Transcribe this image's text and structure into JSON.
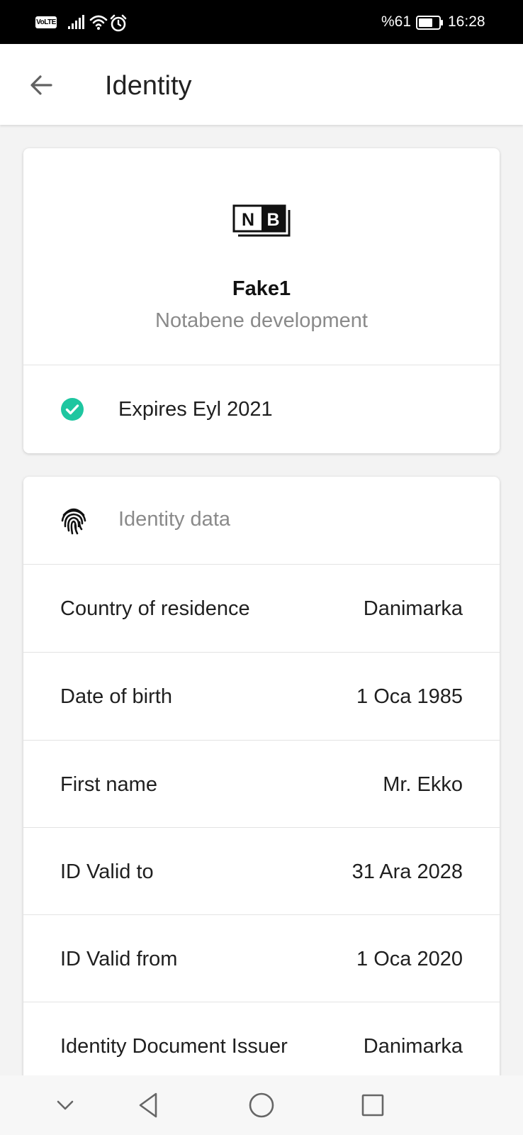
{
  "status_bar": {
    "network_badge": "VoLTE",
    "battery_percent": "%61",
    "time": "16:28",
    "icons": [
      "signal-icon",
      "wifi-icon",
      "alarm-icon",
      "battery-icon"
    ]
  },
  "app_bar": {
    "title": "Identity",
    "back_icon": "arrow-left-icon"
  },
  "issuer_card": {
    "logo_text": "NB",
    "identity_name": "Fake1",
    "issuer_name": "Notabene development",
    "expiry_text": "Expires Eyl 2021",
    "status_color": "#1ec6a0"
  },
  "identity_data": {
    "section_title": "Identity data",
    "section_icon": "fingerprint-icon",
    "rows": [
      {
        "label": "Country of residence",
        "value": "Danimarka"
      },
      {
        "label": "Date of birth",
        "value": "1 Oca 1985"
      },
      {
        "label": "First name",
        "value": "Mr. Ekko"
      },
      {
        "label": "ID Valid to",
        "value": "31 Ara 2028"
      },
      {
        "label": "ID Valid from",
        "value": "1 Oca 2020"
      },
      {
        "label": "Identity Document Issuer",
        "value": "Danimarka"
      }
    ]
  },
  "nav_bar": {
    "buttons": [
      "chevron-down-icon",
      "back-triangle-icon",
      "home-circle-icon",
      "recents-square-icon"
    ]
  }
}
